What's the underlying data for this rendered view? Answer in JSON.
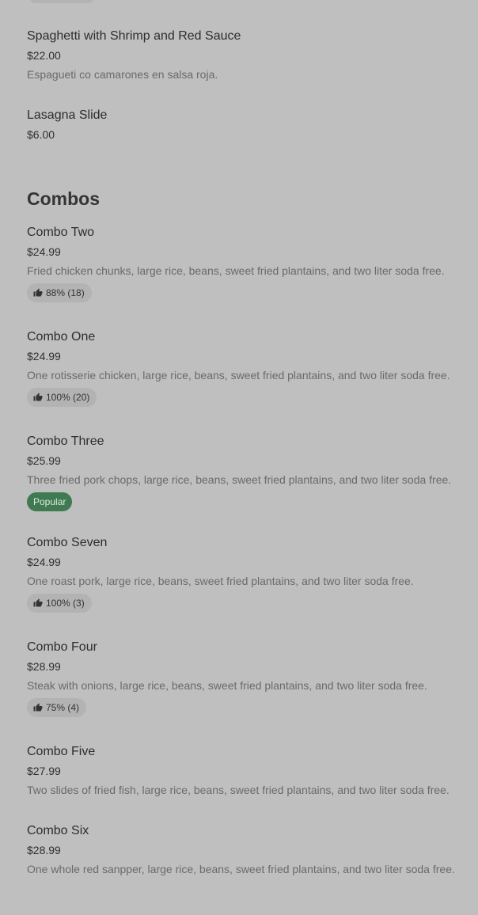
{
  "prev_items": [
    {
      "name": "Spaghetti with Shrimp and Red Sauce",
      "price": "$22.00",
      "description": "Espagueti co camarones en salsa roja."
    },
    {
      "name": "Lasagna Slide",
      "price": "$6.00"
    }
  ],
  "section": {
    "title": "Combos"
  },
  "items": [
    {
      "name": "Combo Two",
      "price": "$24.99",
      "description": "Fried chicken chunks, large rice, beans, sweet fried plantains, and two liter soda free.",
      "rating": "88% (18)"
    },
    {
      "name": "Combo One",
      "price": "$24.99",
      "description": "One rotisserie chicken, large rice, beans, sweet fried plantains, and two liter soda free.",
      "rating": "100% (20)"
    },
    {
      "name": "Combo Three",
      "price": "$25.99",
      "description": "Three fried pork chops, large rice, beans, sweet fried plantains, and two liter soda free.",
      "badge": "Popular"
    },
    {
      "name": "Combo Seven",
      "price": "$24.99",
      "description": "One roast pork, large rice, beans, sweet fried plantains, and two liter soda free.",
      "rating": "100% (3)"
    },
    {
      "name": "Combo Four",
      "price": "$28.99",
      "description": "Steak with onions, large rice, beans, sweet fried plantains, and two liter soda free.",
      "rating": "75% (4)"
    },
    {
      "name": "Combo Five",
      "price": "$27.99",
      "description": "Two slides of fried fish, large rice, beans, sweet fried plantains, and two liter soda free."
    },
    {
      "name": "Combo Six",
      "price": "$28.99",
      "description": "One whole red sanpper, large rice, beans, sweet fried plantains, and two liter soda free."
    }
  ],
  "colors": {
    "background": "#bfbfbf",
    "badge_background": "#b3b3b3",
    "popular_badge": "#3f7a52"
  },
  "icons": {
    "rating": "thumbs-up-icon"
  }
}
